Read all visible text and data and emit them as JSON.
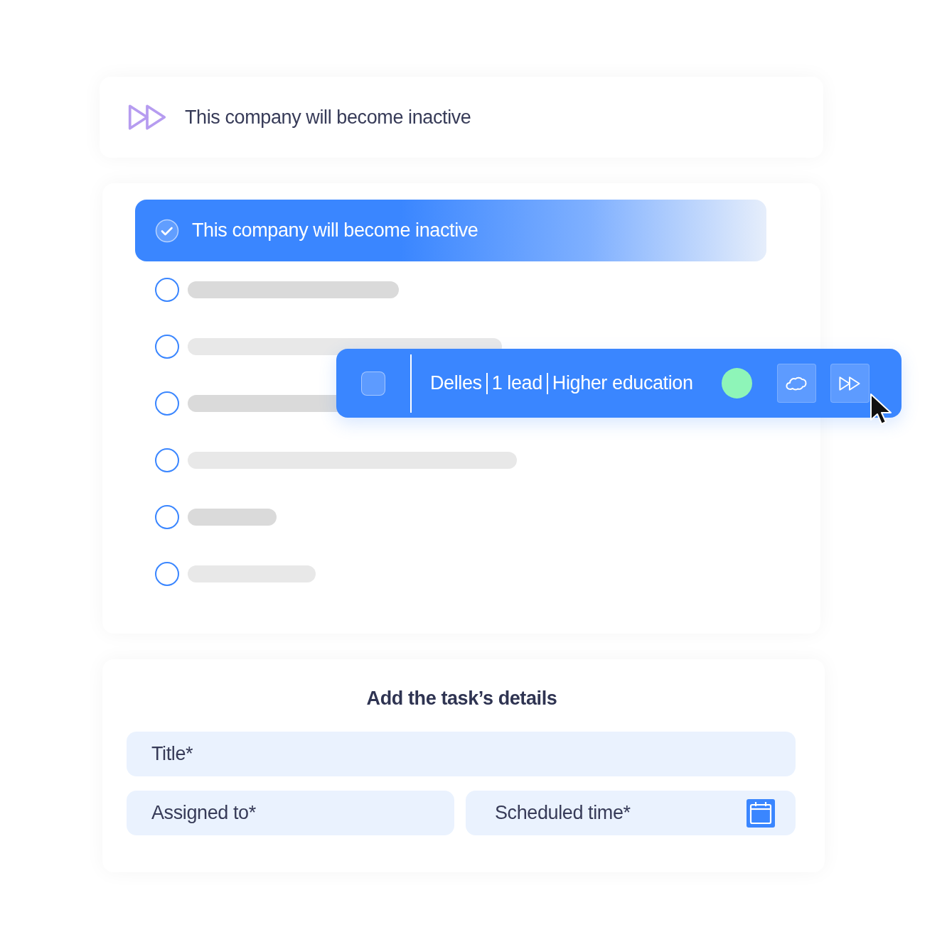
{
  "banner": {
    "text": "This company will become inactive"
  },
  "options": [
    {
      "label": "This company will become inactive",
      "selected": true
    },
    {
      "selected": false
    },
    {
      "selected": false
    },
    {
      "selected": false
    },
    {
      "selected": false
    },
    {
      "selected": false
    },
    {
      "selected": false
    }
  ],
  "toolbar": {
    "checked": false,
    "parts": [
      "Delles",
      "1 lead",
      "Higher education"
    ],
    "status": {
      "color": "#8ef5b8"
    }
  },
  "form": {
    "title": "Add the task’s details",
    "fields": [
      {
        "placeholder": "Title*",
        "kind": "text"
      },
      {
        "placeholder": "Assigned to*",
        "kind": "text"
      },
      {
        "placeholder": "Scheduled time*",
        "kind": "date"
      }
    ]
  }
}
